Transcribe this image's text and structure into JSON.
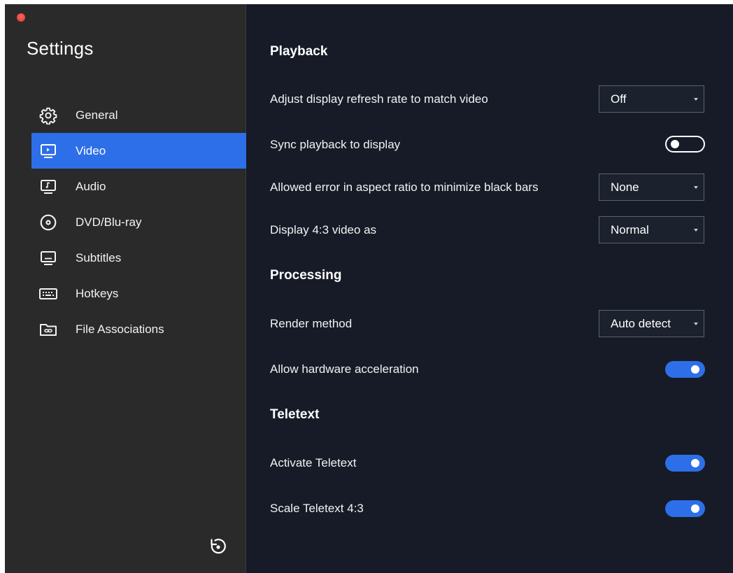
{
  "sidebar": {
    "title": "Settings",
    "items": [
      {
        "label": "General",
        "icon": "gear-icon",
        "active": false
      },
      {
        "label": "Video",
        "icon": "video-icon",
        "active": true
      },
      {
        "label": "Audio",
        "icon": "audio-icon",
        "active": false
      },
      {
        "label": "DVD/Blu-ray",
        "icon": "disc-icon",
        "active": false
      },
      {
        "label": "Subtitles",
        "icon": "subtitles-icon",
        "active": false
      },
      {
        "label": "Hotkeys",
        "icon": "keyboard-icon",
        "active": false
      },
      {
        "label": "File Associations",
        "icon": "folder-link-icon",
        "active": false
      }
    ],
    "reset_icon": "reset-icon"
  },
  "playback": {
    "title": "Playback",
    "refresh_rate": {
      "label": "Adjust display refresh rate to match video",
      "value": "Off"
    },
    "sync": {
      "label": "Sync playback to display",
      "on": false
    },
    "aspect_error": {
      "label": "Allowed error in aspect ratio to minimize black bars",
      "value": "None"
    },
    "display_43": {
      "label": "Display 4:3 video as",
      "value": "Normal"
    }
  },
  "processing": {
    "title": "Processing",
    "render_method": {
      "label": "Render method",
      "value": "Auto detect"
    },
    "hw_accel": {
      "label": "Allow hardware acceleration",
      "on": true
    }
  },
  "teletext": {
    "title": "Teletext",
    "activate": {
      "label": "Activate Teletext",
      "on": true
    },
    "scale": {
      "label": "Scale Teletext 4:3",
      "on": true
    }
  },
  "colors": {
    "accent": "#2d6fe8",
    "sidebar_bg": "#2a2a2b",
    "main_bg": "#161b27"
  }
}
